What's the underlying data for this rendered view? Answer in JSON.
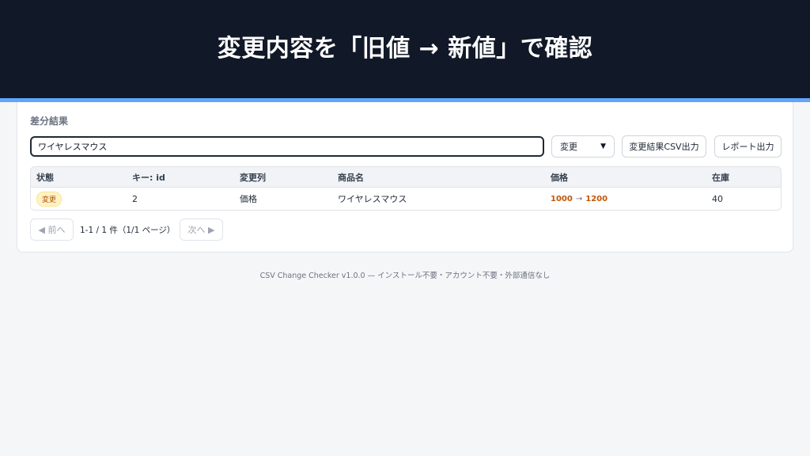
{
  "banner": {
    "title": "変更内容を「旧値 → 新値」で確認"
  },
  "card": {
    "title": "差分結果"
  },
  "search": {
    "value": "ワイヤレスマウス"
  },
  "filter": {
    "selected": "変更"
  },
  "toolbar": {
    "export_label": "変更結果CSV出力",
    "report_label": "レポート出力"
  },
  "table": {
    "headers": [
      "状態",
      "キー: id",
      "変更列",
      "商品名",
      "価格",
      "在庫"
    ],
    "rows": [
      {
        "status": "変更",
        "key": "2",
        "changed_column": "価格",
        "product_name": "ワイヤレスマウス",
        "price_old": "1000",
        "price_arrow": "→",
        "price_new": "1200",
        "stock": "40"
      }
    ]
  },
  "pagination": {
    "prev_label": "前へ",
    "next_label": "次へ",
    "info": "1-1 / 1 件（1/1 ページ）"
  },
  "footer": {
    "text": "CSV Change Checker v1.0.0 — インストール不要・アカウント不要・外部通信なし"
  },
  "colors": {
    "banner_bg": "#111827",
    "accent": "#60a5fa",
    "changed_badge_bg": "#fef3c7",
    "changed_value": "#c2560c"
  }
}
